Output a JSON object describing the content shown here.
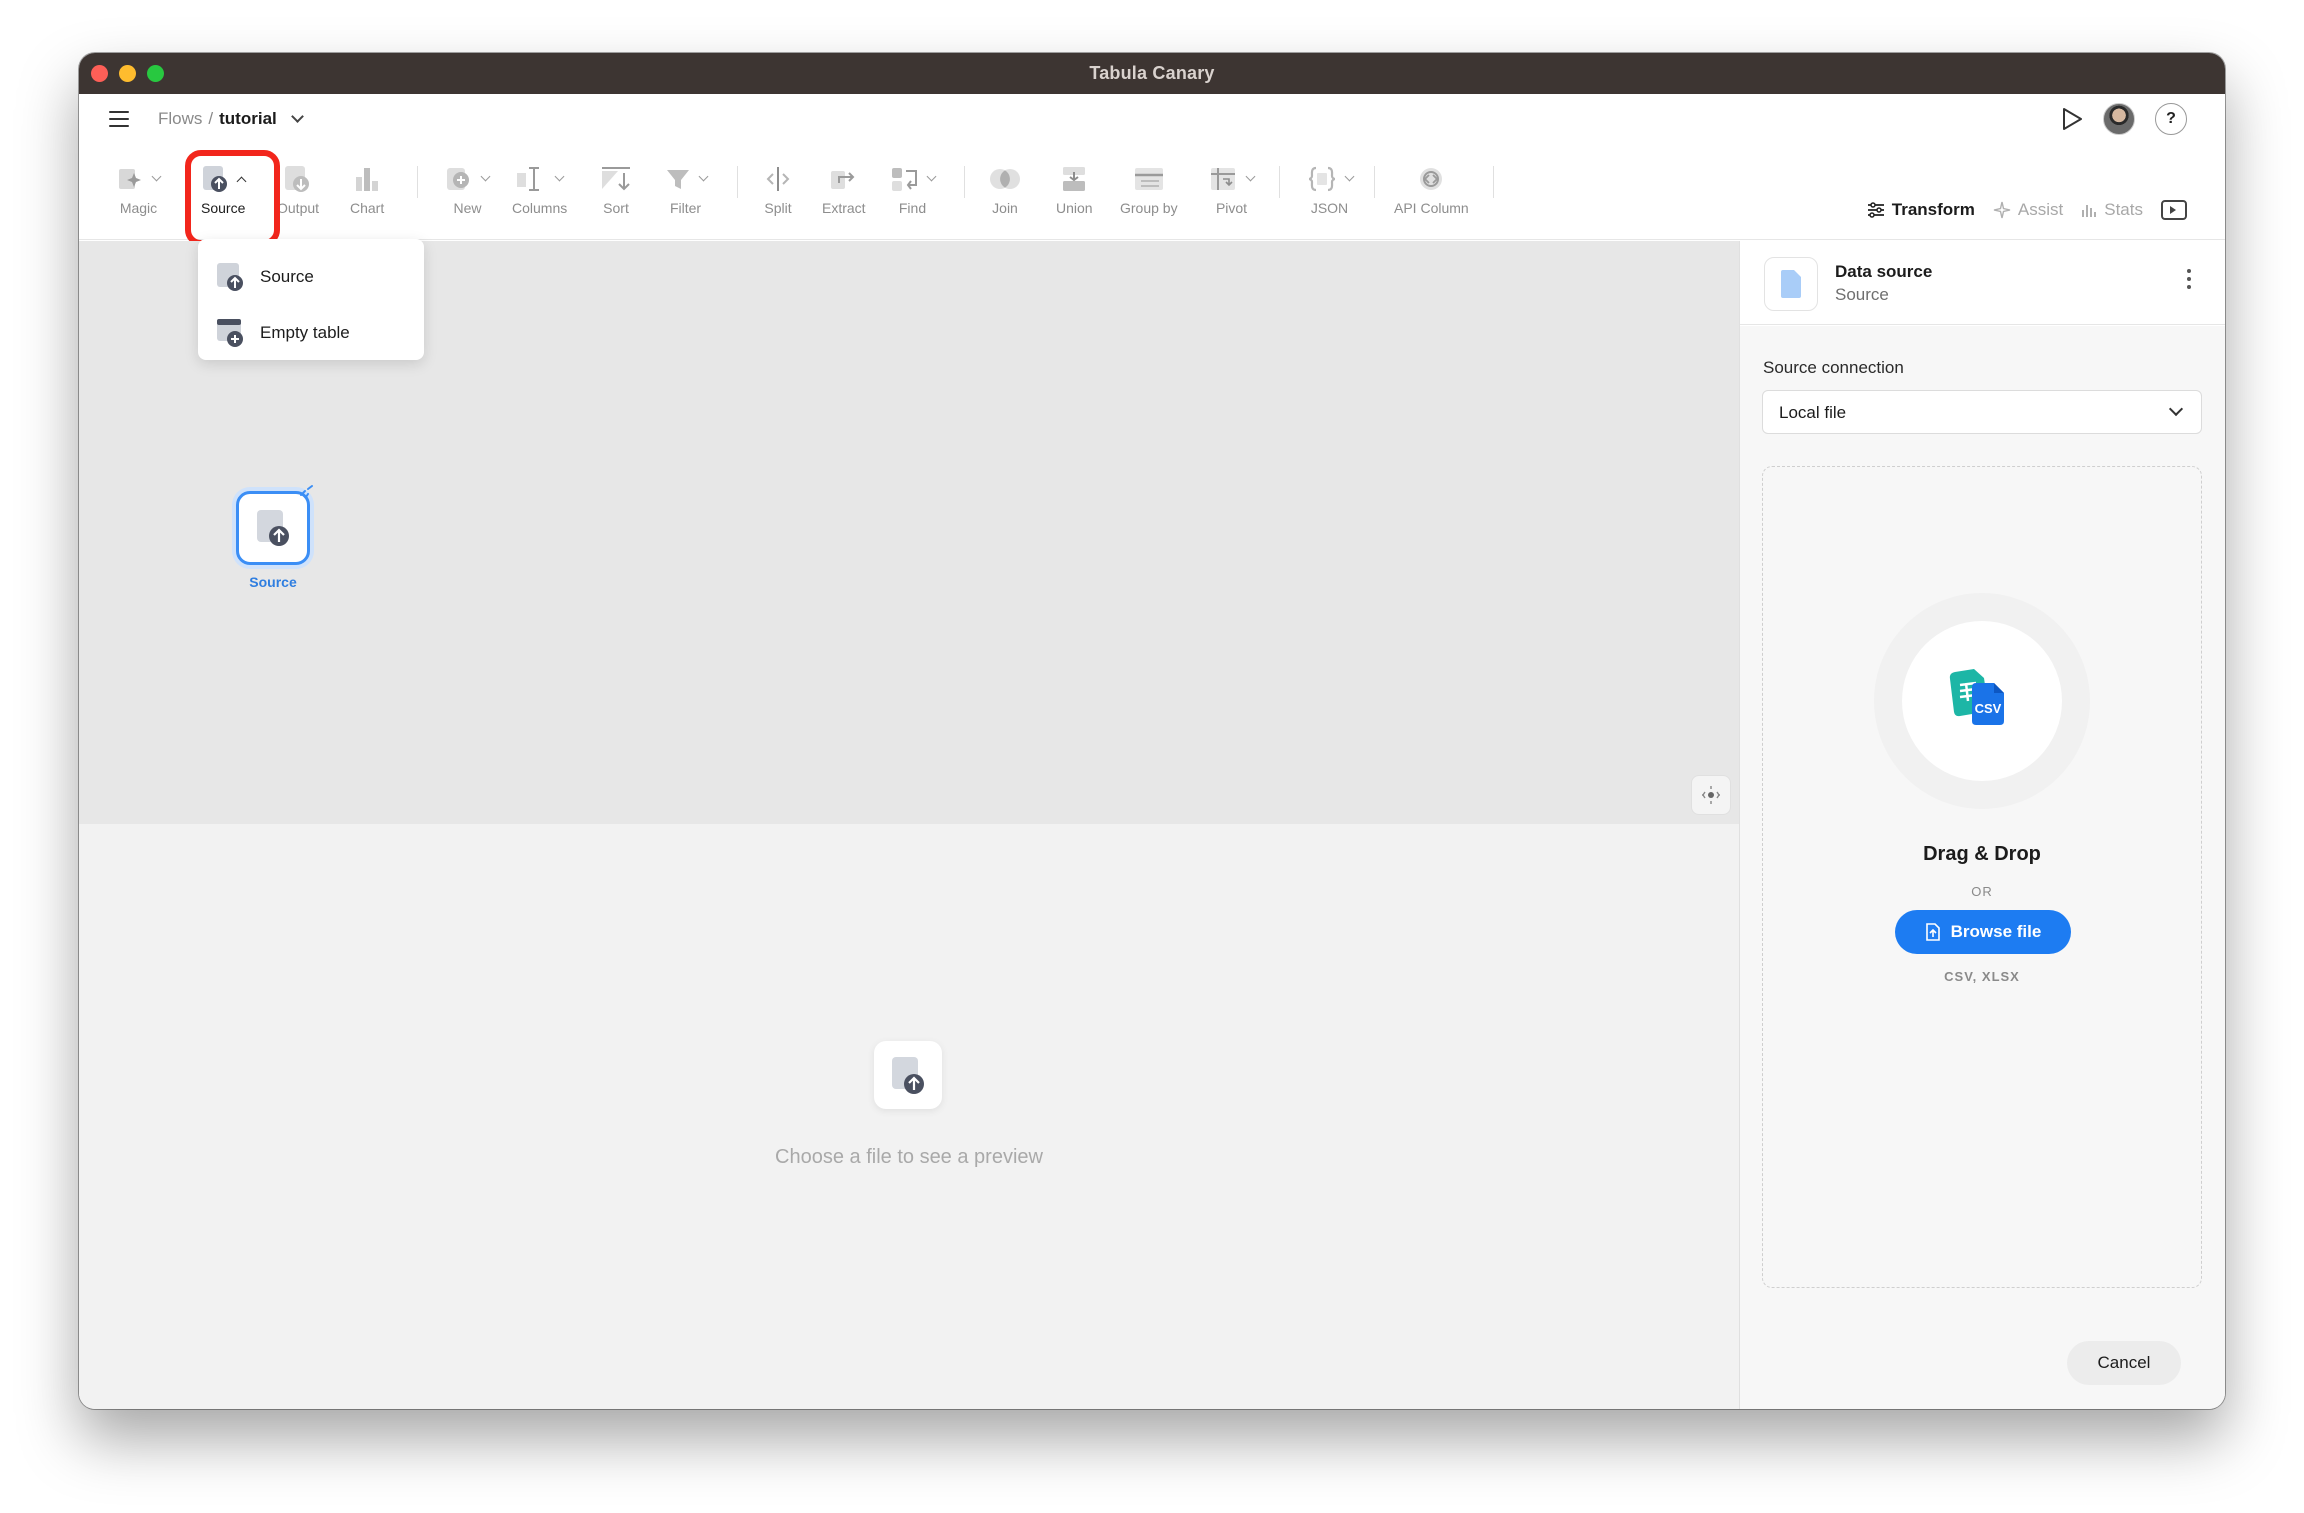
{
  "window": {
    "title": "Tabula Canary"
  },
  "breadcrumb": {
    "parent": "Flows",
    "separator": "/",
    "current": "tutorial"
  },
  "toolbar": {
    "tools": [
      {
        "label": "Magic",
        "icon": "magic-icon"
      },
      {
        "label": "Source",
        "icon": "source-icon"
      },
      {
        "label": "Output",
        "icon": "output-icon"
      },
      {
        "label": "Chart",
        "icon": "chart-icon"
      },
      {
        "label": "New",
        "icon": "new-icon"
      },
      {
        "label": "Columns",
        "icon": "columns-icon"
      },
      {
        "label": "Sort",
        "icon": "sort-icon"
      },
      {
        "label": "Filter",
        "icon": "filter-icon"
      },
      {
        "label": "Split",
        "icon": "split-icon"
      },
      {
        "label": "Extract",
        "icon": "extract-icon"
      },
      {
        "label": "Find",
        "icon": "find-icon"
      },
      {
        "label": "Join",
        "icon": "join-icon"
      },
      {
        "label": "Union",
        "icon": "union-icon"
      },
      {
        "label": "Group by",
        "icon": "group-by-icon"
      },
      {
        "label": "Pivot",
        "icon": "pivot-icon"
      },
      {
        "label": "JSON",
        "icon": "json-icon"
      },
      {
        "label": "API Column",
        "icon": "api-column-icon"
      }
    ]
  },
  "tabs": {
    "transform": "Transform",
    "assist": "Assist",
    "stats": "Stats"
  },
  "source_menu": {
    "items": [
      "Source",
      "Empty table"
    ]
  },
  "canvas": {
    "node_label": "Source"
  },
  "preview": {
    "empty_text": "Choose a file to see a preview"
  },
  "sidebar": {
    "title": "Data source",
    "subtitle": "Source",
    "connection_label": "Source connection",
    "connection_value": "Local file",
    "csv_badge": "CSV",
    "drag_text": "Drag & Drop",
    "or_text": "OR",
    "browse_label": "Browse file",
    "formats": "CSV, XLSX",
    "cancel_label": "Cancel"
  },
  "colors": {
    "accent": "#1d7cf2",
    "highlight": "#f2261c",
    "titlebar": "#3d3532"
  }
}
